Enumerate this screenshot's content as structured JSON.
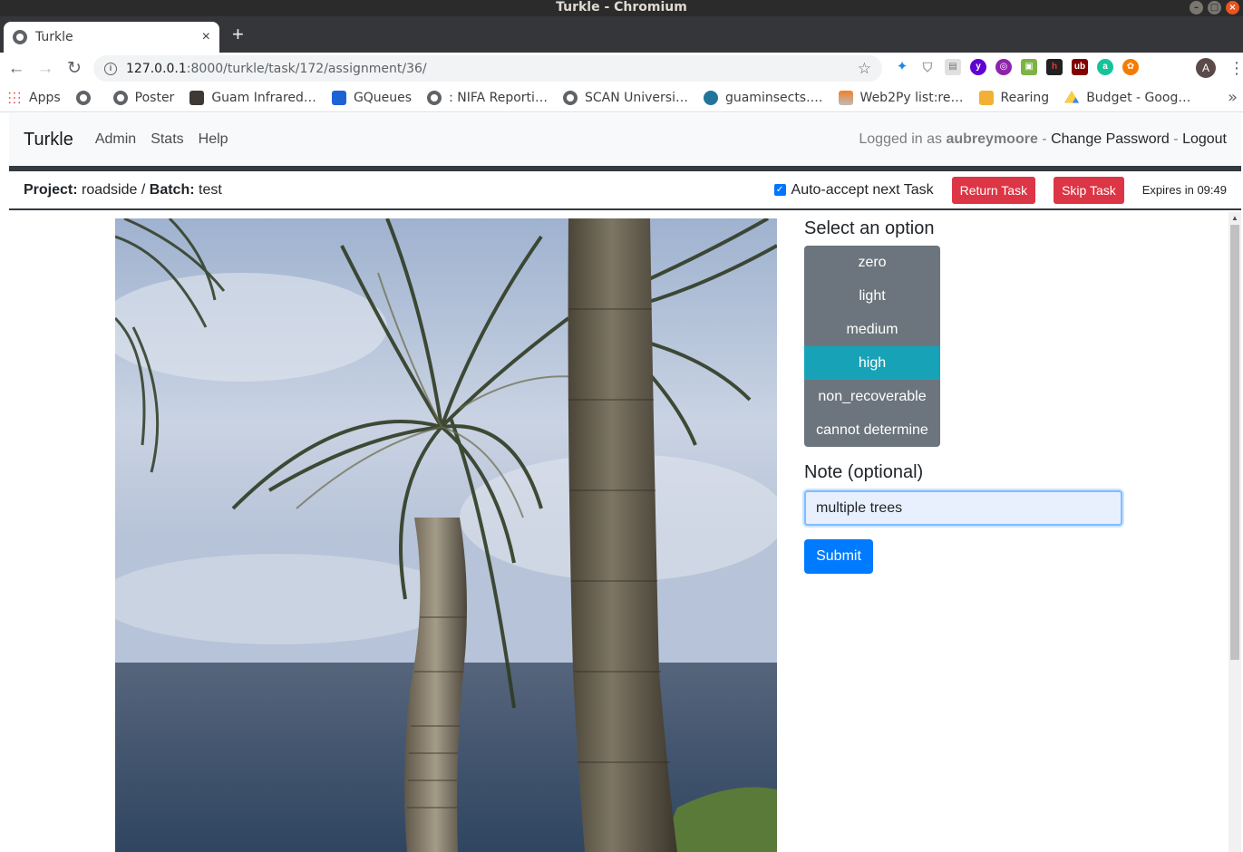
{
  "window": {
    "title": "Turkle - Chromium"
  },
  "tab": {
    "title": "Turkle",
    "close": "×",
    "new_tab": "+"
  },
  "address_bar": {
    "host": "127.0.0.1",
    "path": ":8000/turkle/task/172/assignment/36/"
  },
  "profile": {
    "initial": "A"
  },
  "bookmarks": [
    {
      "label": "Apps",
      "icon": "apps-grid-icon"
    },
    {
      "label": "",
      "icon": "globe-icon"
    },
    {
      "label": "Poster",
      "icon": "globe-icon"
    },
    {
      "label": "Guam Infrared…",
      "icon": "image-icon"
    },
    {
      "label": "GQueues",
      "icon": "gqueues-icon"
    },
    {
      "label": ": NIFA Reporti…",
      "icon": "globe-icon"
    },
    {
      "label": "SCAN Universi…",
      "icon": "globe-icon"
    },
    {
      "label": "guaminsects.…",
      "icon": "wordpress-icon"
    },
    {
      "label": "Web2Py list:re…",
      "icon": "stackoverflow-icon"
    },
    {
      "label": "Rearing",
      "icon": "w2p-icon"
    },
    {
      "label": "Budget - Goog…",
      "icon": "drive-icon"
    }
  ],
  "navbar": {
    "brand": "Turkle",
    "links": [
      "Admin",
      "Stats",
      "Help"
    ],
    "logged_in_prefix": "Logged in as",
    "username": "aubreymoore",
    "change_password": "Change Password",
    "logout": "Logout",
    "separator": "-"
  },
  "task_header": {
    "project_label": "Project:",
    "project": "roadside",
    "batch_label": "Batch:",
    "batch": "test",
    "separator": "/",
    "auto_accept_label": "Auto-accept next Task",
    "auto_accept_checked": true,
    "return_task": "Return Task",
    "skip_task": "Skip Task",
    "expires": "Expires in 09:49"
  },
  "form": {
    "select_heading": "Select an option",
    "options": [
      "zero",
      "light",
      "medium",
      "high",
      "non_recoverable",
      "cannot determine"
    ],
    "selected_option": "high",
    "note_label": "Note (optional)",
    "note_value": "multiple trees",
    "submit": "Submit"
  },
  "colors": {
    "option_bg": "#6c757d",
    "option_active": "#17a2b8",
    "danger": "#dc3545",
    "primary": "#007bff",
    "navbar_rule": "#343a40"
  }
}
